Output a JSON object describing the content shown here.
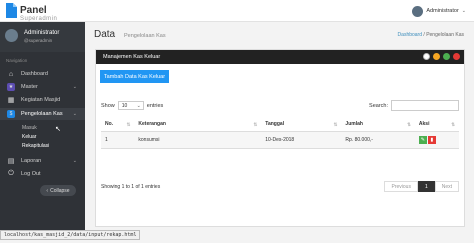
{
  "topbar": {
    "brand": "Panel",
    "brand_sub": "Superadmin",
    "user_name": "Administrator"
  },
  "sidebar": {
    "user_name": "Administrator",
    "user_handle": "@superadmin",
    "section_label": "Navigation",
    "items": [
      {
        "label": "Dashboard",
        "icon": "dashboard-icon"
      },
      {
        "label": "Master",
        "icon": "master-icon"
      },
      {
        "label": "Kegiatan Masjid",
        "icon": "calendar-icon"
      },
      {
        "label": "Pengelolaan Kas",
        "icon": "cash-icon"
      },
      {
        "label": "Laporan",
        "icon": "print-icon"
      },
      {
        "label": "Log Out",
        "icon": "power-icon"
      }
    ],
    "sub_items": [
      "Masuk",
      "Keluar",
      "Rekapitulasi"
    ],
    "collapse_label": "Collapse"
  },
  "main": {
    "title": "Data",
    "subtitle": "Pengelolaan Kas",
    "breadcrumb": [
      "Dashboard",
      "Pengelolaan Kas"
    ]
  },
  "panel": {
    "header": "Manajemen Kas Keluar",
    "add_button": "Tambah Data Kas Keluar",
    "show_label": "Show",
    "show_value": "10",
    "entries_label": "entries",
    "search_label": "Search:",
    "search_value": "",
    "table": {
      "columns": [
        "No.",
        "Keterangan",
        "Tanggal",
        "Jumlah",
        "Aksi"
      ],
      "rows": [
        {
          "no": "1",
          "keterangan": "konsumsi",
          "tanggal": "10-Des-2018",
          "jumlah": "Rp. 80.000,-"
        }
      ]
    },
    "info": "Showing 1 to 1 of 1 entries",
    "pager": {
      "prev": "Previous",
      "current": "1",
      "next": "Next"
    },
    "dot_colors": [
      "#ffffff",
      "#f5a623",
      "#4caf50",
      "#e53935"
    ]
  },
  "status_url": "localhost/kas_masjid_2/data/input/rekap.html"
}
